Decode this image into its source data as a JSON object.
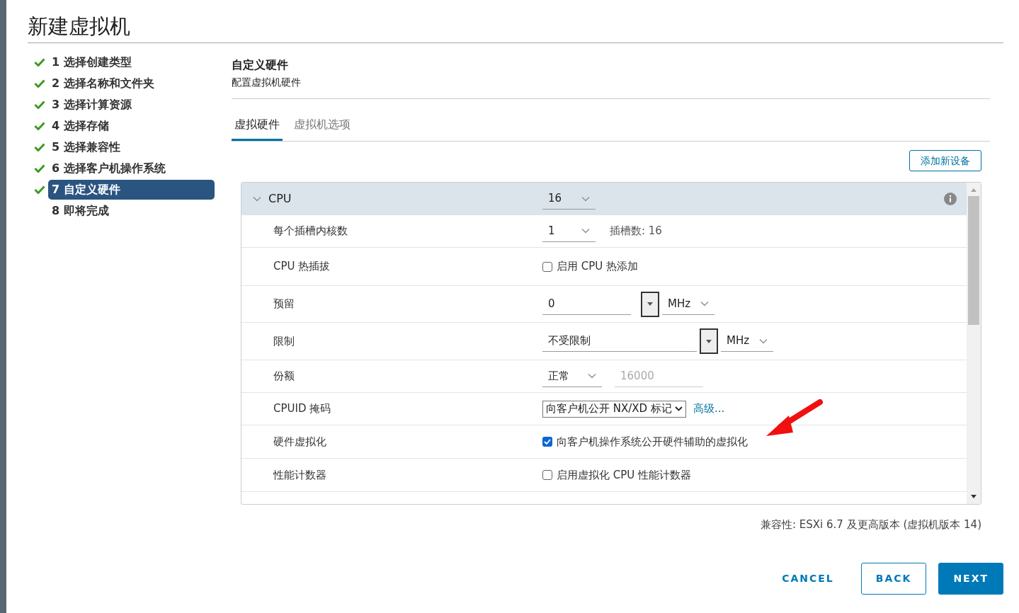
{
  "window": {
    "title": "新建虚拟机"
  },
  "steps": [
    {
      "label": "1 选择创建类型",
      "done": true,
      "selected": false
    },
    {
      "label": "2 选择名称和文件夹",
      "done": true,
      "selected": false
    },
    {
      "label": "3 选择计算资源",
      "done": true,
      "selected": false
    },
    {
      "label": "4 选择存储",
      "done": true,
      "selected": false
    },
    {
      "label": "5 选择兼容性",
      "done": true,
      "selected": false
    },
    {
      "label": "6 选择客户机操作系统",
      "done": true,
      "selected": false
    },
    {
      "label": "7 自定义硬件",
      "done": true,
      "selected": true
    },
    {
      "label": "8 即将完成",
      "done": false,
      "selected": false
    }
  ],
  "page": {
    "title": "自定义硬件",
    "subtitle": "配置虚拟机硬件"
  },
  "tabs": [
    {
      "label": "虚拟硬件",
      "selected": true
    },
    {
      "label": "虚拟机选项",
      "selected": false
    }
  ],
  "add_button": "添加新设备",
  "group": {
    "label": "CPU",
    "expanded": true,
    "value": "16"
  },
  "rows": [
    {
      "kind": "dropdown",
      "label": "每个插槽内核数",
      "value": "1",
      "note": "插槽数: 16"
    },
    {
      "kind": "checkbox",
      "label": "CPU 热插拔",
      "checked": false,
      "text": "启用 CPU 热添加"
    },
    {
      "kind": "amount",
      "label": "预留",
      "value": "0",
      "unit": "MHz"
    },
    {
      "kind": "amount",
      "label": "限制",
      "value": "不受限制",
      "unit": "MHz",
      "wide": true
    },
    {
      "kind": "shares",
      "label": "份额",
      "value": "正常",
      "amount": "16000"
    },
    {
      "kind": "select",
      "label": "CPUID 掩码",
      "value": "向客户机公开 NX/XD 标记",
      "link": "高级..."
    },
    {
      "kind": "checkbox",
      "label": "硬件虚拟化",
      "checked": true,
      "text": "向客户机操作系统公开硬件辅助的虚拟化"
    },
    {
      "kind": "checkbox",
      "label": "性能计数器",
      "checked": false,
      "text": "启用虚拟化 CPU 性能计数器"
    }
  ],
  "compatibility": "兼容性: ESXi 6.7 及更高版本 (虚拟机版本 14)",
  "buttons": [
    {
      "kind": "link",
      "label": "CANCEL"
    },
    {
      "kind": "outline",
      "label": "BACK"
    },
    {
      "kind": "primary",
      "label": "NEXT"
    }
  ]
}
